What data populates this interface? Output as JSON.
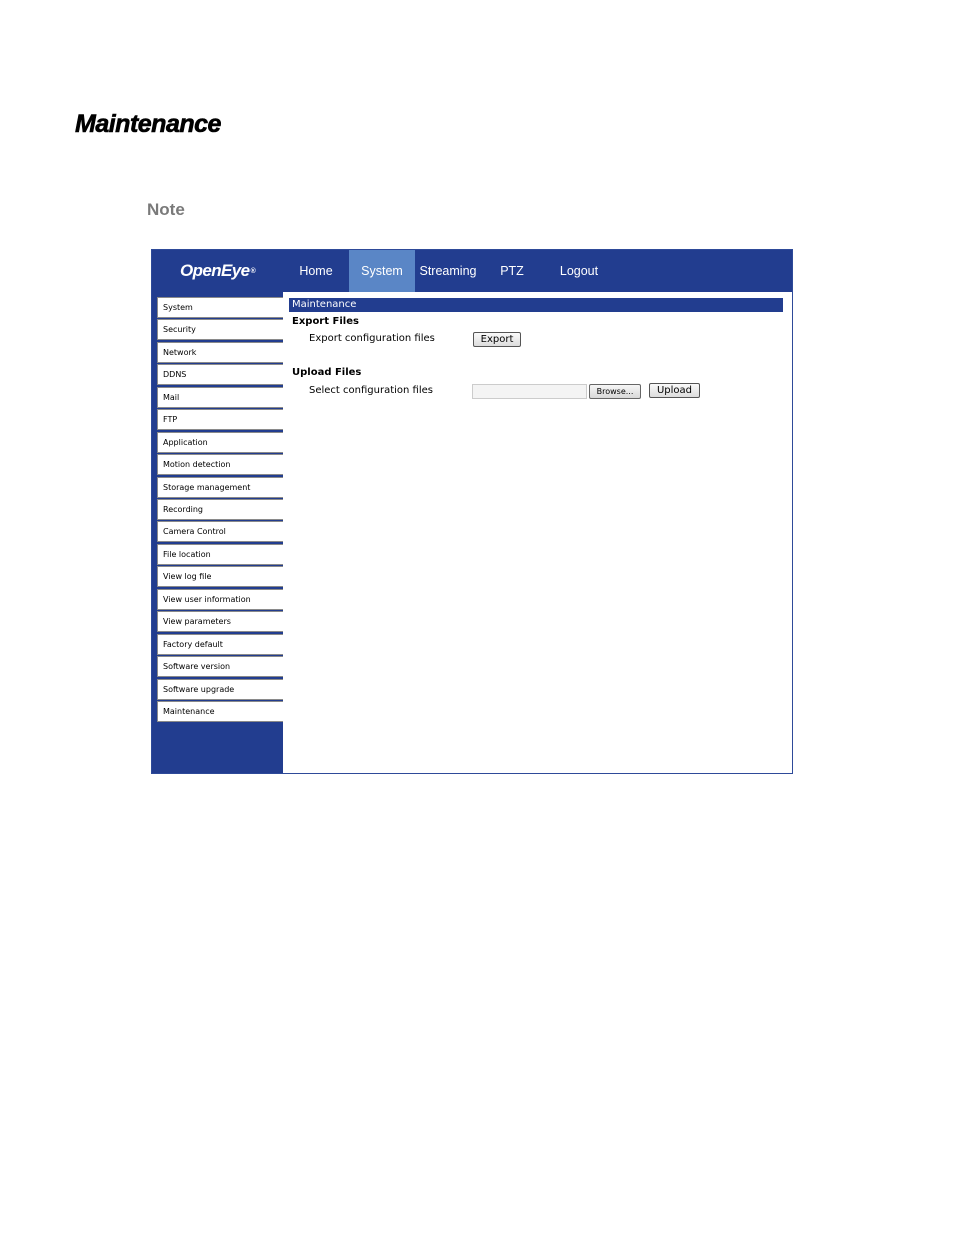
{
  "document": {
    "title": "Maintenance",
    "note_label": "Note"
  },
  "app": {
    "logo_text": "OpenEye",
    "logo_mark": "®",
    "nav": [
      {
        "label": "Home",
        "active": false
      },
      {
        "label": "System",
        "active": true
      },
      {
        "label": "Streaming",
        "active": false
      },
      {
        "label": "PTZ",
        "active": false
      },
      {
        "label": "Logout",
        "active": false
      }
    ],
    "sidebar": [
      "System",
      "Security",
      "Network",
      "DDNS",
      "Mail",
      "FTP",
      "Application",
      "Motion detection",
      "Storage management",
      "Recording",
      "Camera Control",
      "File location",
      "View log file",
      "View user information",
      "View parameters",
      "Factory default",
      "Software version",
      "Software upgrade",
      "Maintenance"
    ],
    "content": {
      "section_title": "Maintenance",
      "export": {
        "title": "Export Files",
        "label": "Export configuration files",
        "button": "Export"
      },
      "upload": {
        "title": "Upload Files",
        "label": "Select configuration files",
        "file_value": "",
        "browse_button": "Browse...",
        "button": "Upload"
      }
    },
    "colors": {
      "header_bg": "#223d8f",
      "active_tab_bg": "#5a86c6",
      "note_text": "#7a7a7a"
    }
  }
}
